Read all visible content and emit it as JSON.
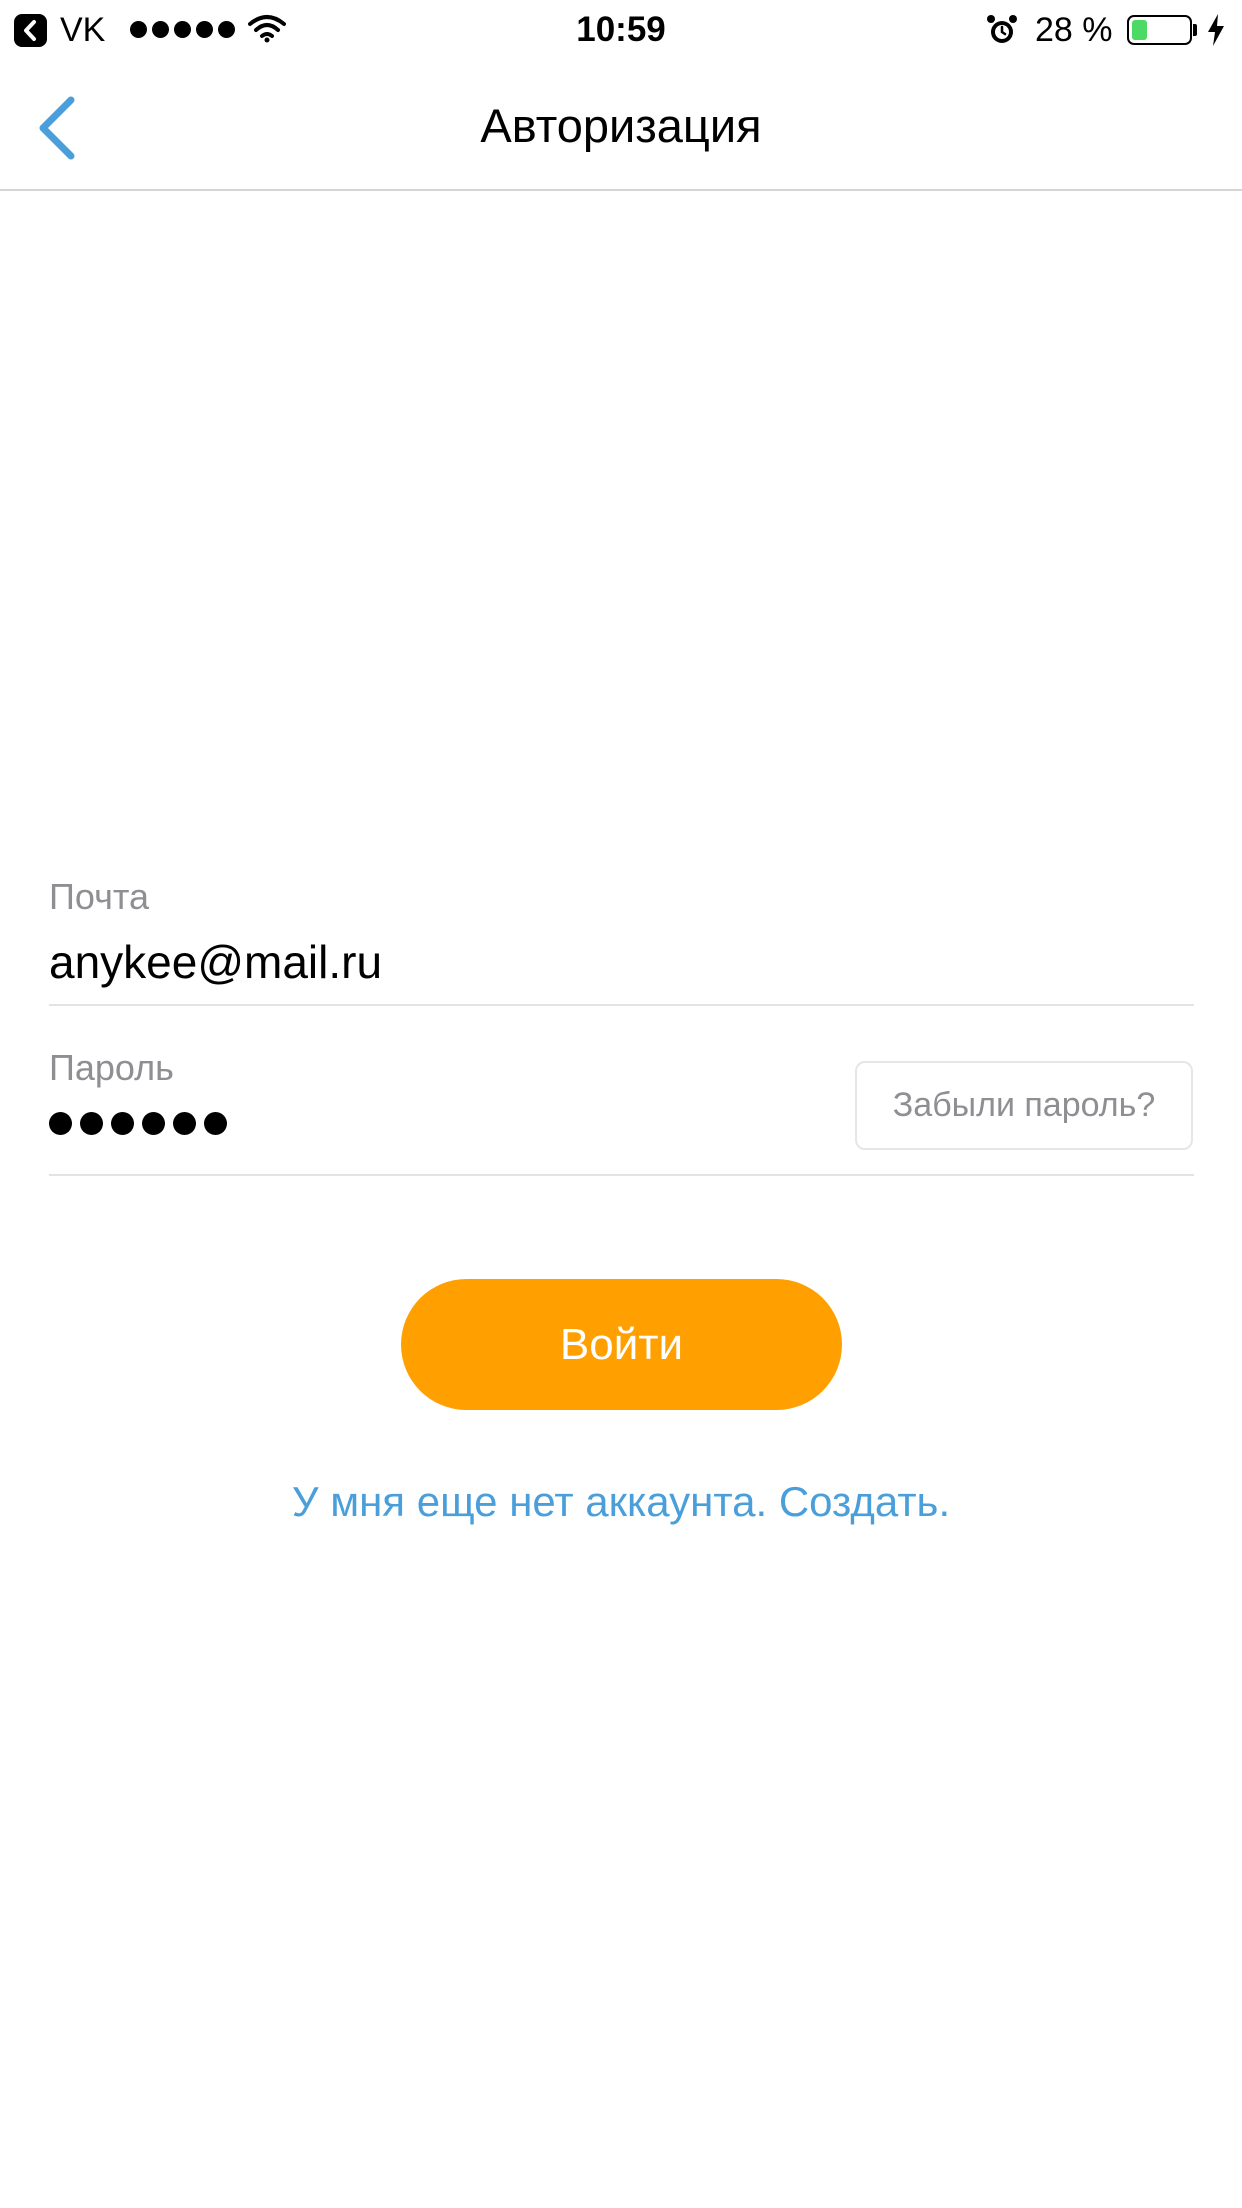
{
  "status_bar": {
    "back_app_icon": "chevron-left-icon",
    "back_app_label": "VK",
    "signal_dots": 5,
    "wifi_icon": "wifi-icon",
    "time": "10:59",
    "alarm_icon": "alarm-clock-icon",
    "battery_text": "28 %",
    "battery_level": 0.28,
    "battery_color": "#4cd964",
    "charging_icon": "lightning-bolt-icon"
  },
  "nav_bar": {
    "back_icon": "chevron-left-icon",
    "title": "Авторизация"
  },
  "form": {
    "email_label": "Почта",
    "email_value": "anykee@mail.ru",
    "password_label": "Пароль",
    "password_masked_length": 6,
    "forgot_password_label": "Забыли пароль?"
  },
  "actions": {
    "login_label": "Войти",
    "login_color": "#ff9f00",
    "signup_link": "У мня еще нет аккаунта. Создать.",
    "link_color": "#4a9fdb",
    "accent_color": "#4a9fdb"
  }
}
